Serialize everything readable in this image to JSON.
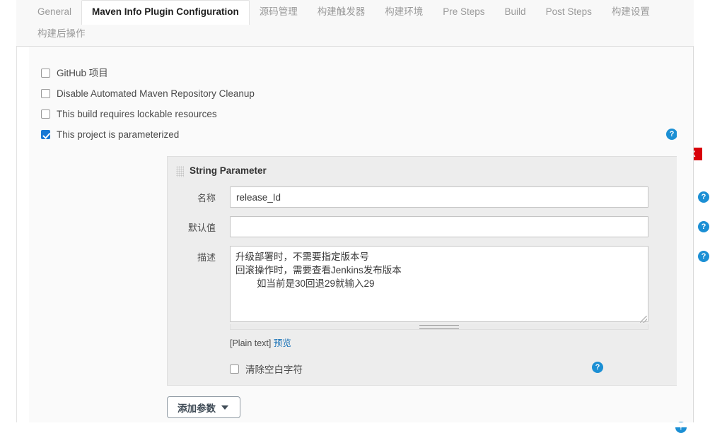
{
  "tabs": {
    "row1": [
      {
        "label": "General",
        "active": false
      },
      {
        "label": "Maven Info Plugin Configuration",
        "active": true
      },
      {
        "label": "源码管理",
        "active": false
      },
      {
        "label": "构建触发器",
        "active": false
      },
      {
        "label": "构建环境",
        "active": false
      },
      {
        "label": "Pre Steps",
        "active": false
      },
      {
        "label": "Build",
        "active": false
      },
      {
        "label": "Post Steps",
        "active": false
      },
      {
        "label": "构建设置",
        "active": false
      }
    ],
    "row2": [
      {
        "label": "构建后操作",
        "active": false
      }
    ]
  },
  "options": [
    {
      "label": "GitHub 项目",
      "checked": false,
      "help": false
    },
    {
      "label": "Disable Automated Maven Repository Cleanup",
      "checked": false,
      "help": false
    },
    {
      "label": "This build requires lockable resources",
      "checked": false,
      "help": false
    },
    {
      "label": "This project is parameterized",
      "checked": true,
      "help": true
    }
  ],
  "parameter": {
    "title": "String Parameter",
    "delete_label": "X",
    "fields": {
      "name_label": "名称",
      "name_value": "release_Id",
      "default_label": "默认值",
      "default_value": "",
      "description_label": "描述",
      "description_value": "升级部署时，不需要指定版本号\n回滚操作时，需要查看Jenkins发布版本\n        如当前是30回退29就输入29"
    },
    "plain_text_label": "[Plain text]",
    "preview_link": "预览",
    "trim_label": "清除空白字符",
    "trim_checked": false
  },
  "add_parameter_button": "添加参数",
  "icons": {
    "help": "?",
    "drag_grip": "drag-grip",
    "caret_down": "▼"
  },
  "colors": {
    "accent_blue": "#1b8fd4",
    "checkbox_checked": "#1878d4",
    "delete_red": "#d8010a",
    "link_blue": "#1a73b8",
    "panel_bg": "#ededed",
    "page_bg": "#fafafa"
  }
}
